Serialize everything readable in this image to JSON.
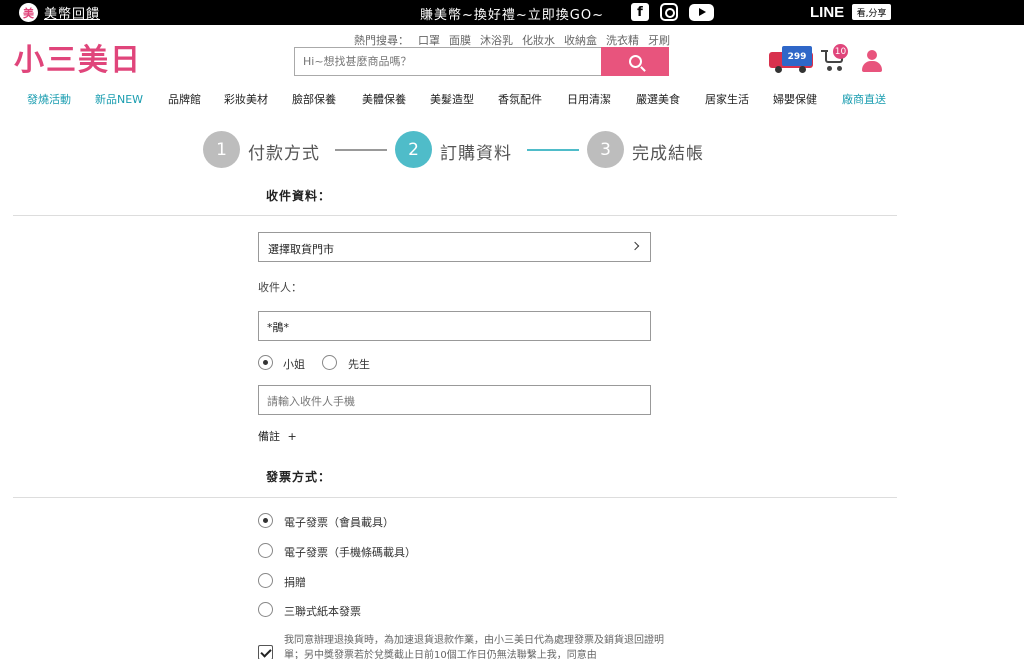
{
  "topbar": {
    "badge": "美",
    "left_link": "美幣回饋",
    "promo": "賺美幣~換好禮~立即換GO~",
    "social": {
      "facebook": "f",
      "line": "LINE",
      "share": "看,分享"
    }
  },
  "header": {
    "logo": "小三美日",
    "hot_title": "熱門搜尋：",
    "hot_terms": [
      "口罩",
      "面膜",
      "沐浴乳",
      "化妝水",
      "收納盒",
      "洗衣精",
      "牙刷"
    ],
    "search_placeholder": "Hi~想找甚麼商品嗎？",
    "truck_tag": "299",
    "cart_count": "10"
  },
  "nav": [
    "發燒活動",
    "新品NEW",
    "品牌館",
    "彩妝美材",
    "臉部保養",
    "美體保養",
    "美髮造型",
    "香氛配件",
    "日用清潔",
    "嚴選美食",
    "居家生活",
    "婦嬰保健",
    "廠商直送"
  ],
  "steps": [
    {
      "num": "1",
      "label": "付款方式"
    },
    {
      "num": "2",
      "label": "訂購資料"
    },
    {
      "num": "3",
      "label": "完成結帳"
    }
  ],
  "shipping": {
    "title": "收件資料：",
    "store_select": "選擇取貨門市",
    "recipient_label": "收件人：",
    "recipient_value": "*鵑*",
    "gender": [
      "小姐",
      "先生"
    ],
    "phone_placeholder": "請輸入收件人手機",
    "note_label": "備註",
    "note_plus": "+"
  },
  "invoice": {
    "title": "發票方式：",
    "options": [
      "電子發票（會員載具）",
      "電子發票（手機條碼載具）",
      "捐贈",
      "三聯式紙本發票"
    ],
    "agree_text": "我同意辦理退換貨時，為加速退貨退款作業，由小三美日代為處理發票及銷貨退回證明單；另中獎發票若於兌獎截止日前10個工作日仍無法聯繫上我，同意由"
  }
}
